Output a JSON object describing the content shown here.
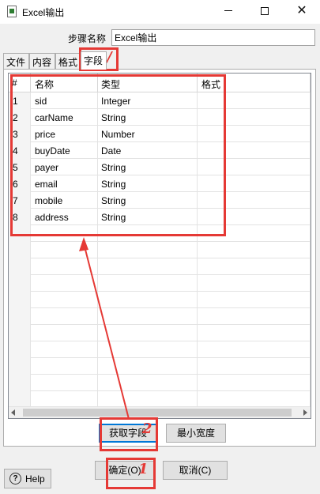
{
  "window": {
    "title": "Excel输出"
  },
  "step": {
    "label": "步骤名称",
    "value": "Excel输出"
  },
  "tabs": [
    "文件",
    "内容",
    "格式",
    "字段"
  ],
  "table": {
    "headers": {
      "num": "#",
      "name": "名称",
      "type": "类型",
      "format": "格式"
    },
    "rows": [
      {
        "num": "1",
        "name": "sid",
        "type": "Integer",
        "format": ""
      },
      {
        "num": "2",
        "name": "carName",
        "type": "String",
        "format": ""
      },
      {
        "num": "3",
        "name": "price",
        "type": "Number",
        "format": ""
      },
      {
        "num": "4",
        "name": "buyDate",
        "type": "Date",
        "format": ""
      },
      {
        "num": "5",
        "name": "payer",
        "type": "String",
        "format": ""
      },
      {
        "num": "6",
        "name": "email",
        "type": "String",
        "format": ""
      },
      {
        "num": "7",
        "name": "mobile",
        "type": "String",
        "format": ""
      },
      {
        "num": "8",
        "name": "address",
        "type": "String",
        "format": ""
      }
    ]
  },
  "buttons": {
    "get_fields": "获取字段",
    "min_width": "最小宽度",
    "ok": "确定(O)",
    "cancel": "取消(C)",
    "help": "Help"
  },
  "annotations": {
    "one": "1",
    "two": "2",
    "tab_mark": "/"
  },
  "colors": {
    "annotation": "#e53935",
    "focus": "#0078d7"
  }
}
